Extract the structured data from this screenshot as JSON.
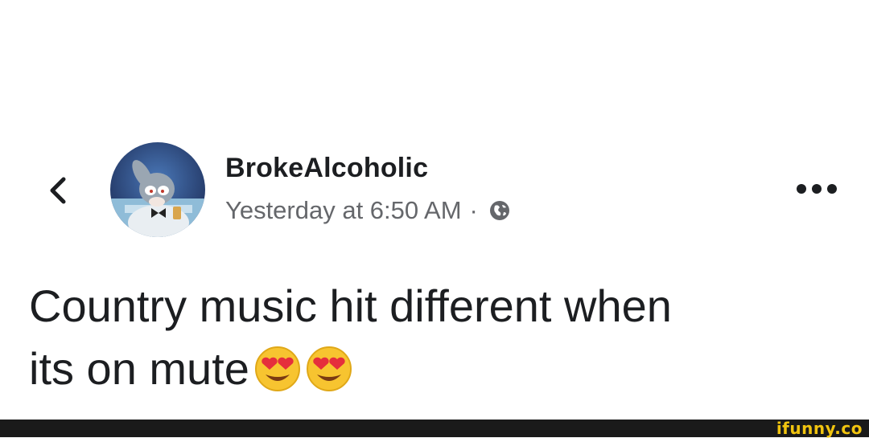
{
  "header": {
    "back_icon": "chevron-left-icon",
    "author_name": "BrokeAlcoholic",
    "timestamp": "Yesterday at 6:50 AM",
    "separator": "·",
    "privacy_icon": "globe-icon",
    "more_icon": "more-horizontal-icon"
  },
  "post": {
    "line1": "Country music hit different when",
    "line2": "its on mute",
    "emojis": [
      "heart-eyes-emoji",
      "heart-eyes-emoji"
    ]
  },
  "footer": {
    "watermark": "ifunny.co"
  },
  "colors": {
    "text_primary": "#1c1e21",
    "text_secondary": "#65676b",
    "footer_bg": "#1a1a1a",
    "watermark": "#f1c40f"
  }
}
